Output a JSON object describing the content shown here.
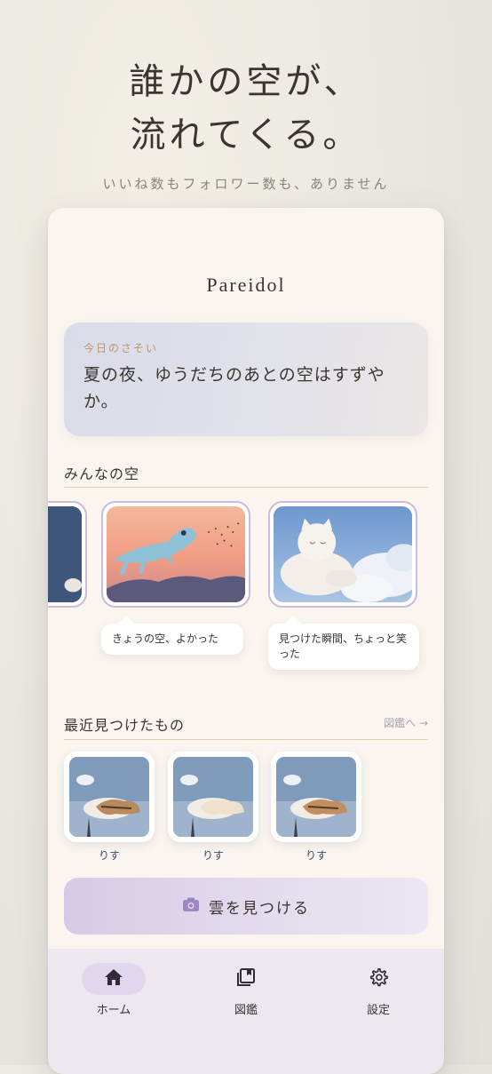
{
  "hero": {
    "title_line1": "誰かの空が、",
    "title_line2": "流れてくる。",
    "subtitle": "いいね数もフォロワー数も、ありません"
  },
  "app": {
    "title": "Pareidol"
  },
  "prompt": {
    "label": "今日のさそい",
    "text": "夏の夜、ゆうだちのあとの空はすずやか。"
  },
  "feed": {
    "title": "みんなの空",
    "cards": [
      {
        "caption": "きょうの空、よかった",
        "icon": "lizard-cloud-sunset"
      },
      {
        "caption": "見つけた瞬間、ちょっと笑った",
        "icon": "cat-cloud-blue-sky"
      }
    ]
  },
  "recent": {
    "title": "最近見つけたもの",
    "link": "図鑑へ →",
    "items": [
      {
        "label": "りす"
      },
      {
        "label": "りす"
      },
      {
        "label": "りす"
      }
    ]
  },
  "action": {
    "label": "雲を見つける",
    "icon": "camera-icon"
  },
  "nav": {
    "items": [
      {
        "label": "ホーム",
        "icon": "home-icon",
        "active": true
      },
      {
        "label": "図鑑",
        "icon": "book-icon",
        "active": false
      },
      {
        "label": "設定",
        "icon": "gear-icon",
        "active": false
      }
    ]
  },
  "colors": {
    "accent": "#cabbe0",
    "button": "#d6cbe6",
    "nav_bg": "#ede8f0",
    "card_bg": "#faf6ef"
  }
}
